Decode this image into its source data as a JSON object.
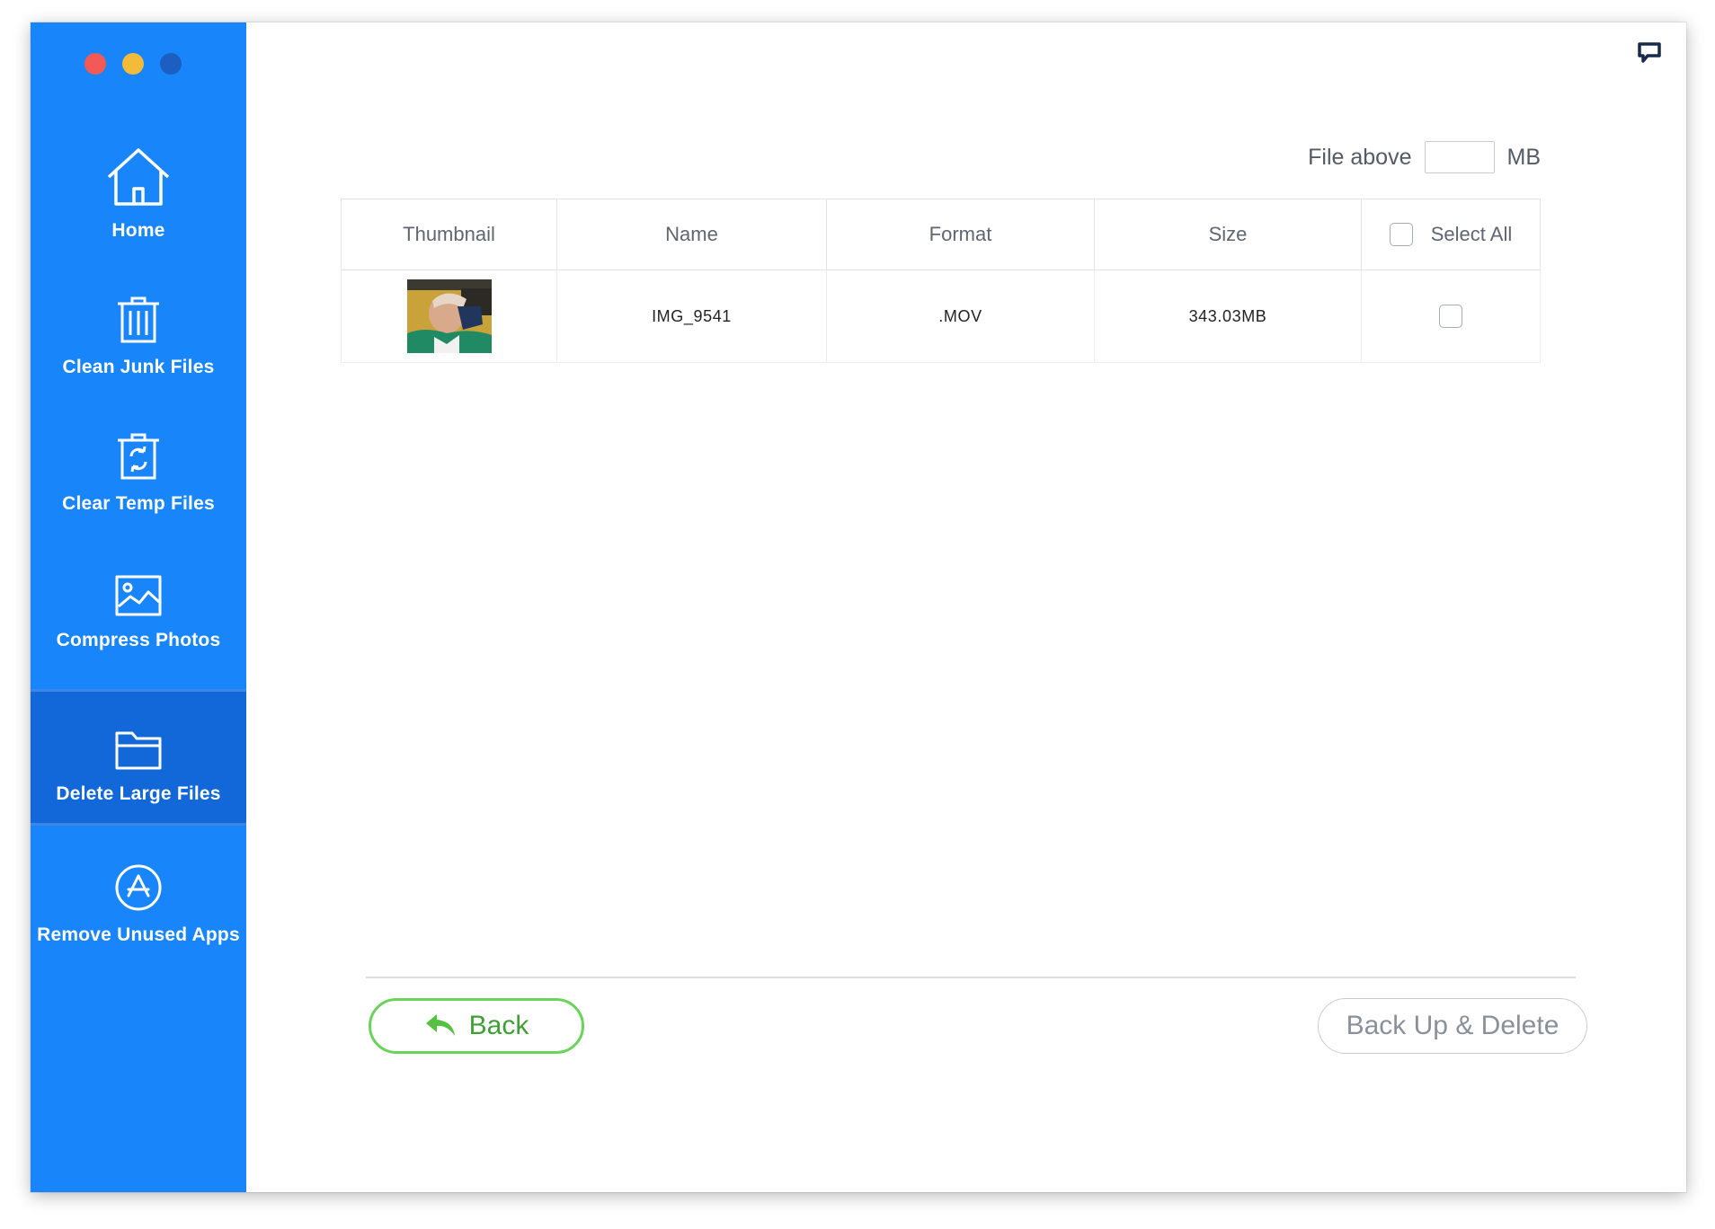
{
  "sidebar": {
    "items": [
      {
        "label": "Home",
        "icon": "home-icon"
      },
      {
        "label": "Clean Junk Files",
        "icon": "trash-icon"
      },
      {
        "label": "Clear Temp Files",
        "icon": "recycle-bin-icon"
      },
      {
        "label": "Compress Photos",
        "icon": "photo-icon"
      },
      {
        "label": "Delete Large Files",
        "icon": "folder-icon",
        "active": true
      },
      {
        "label": "Remove Unused Apps",
        "icon": "app-store-icon"
      }
    ]
  },
  "filter": {
    "prefix": "File above",
    "value": "",
    "unit": "MB"
  },
  "table": {
    "headers": [
      "Thumbnail",
      "Name",
      "Format",
      "Size"
    ],
    "select_all_label": "Select All",
    "rows": [
      {
        "name": "IMG_9541",
        "format": ".MOV",
        "size": "343.03MB",
        "checked": false
      }
    ]
  },
  "footer": {
    "back_label": "Back",
    "delete_label": "Back Up & Delete"
  },
  "colors": {
    "sidebar": "#1985fb",
    "sidebar_active": "#1267d9",
    "back_green": "#6ad35a"
  }
}
